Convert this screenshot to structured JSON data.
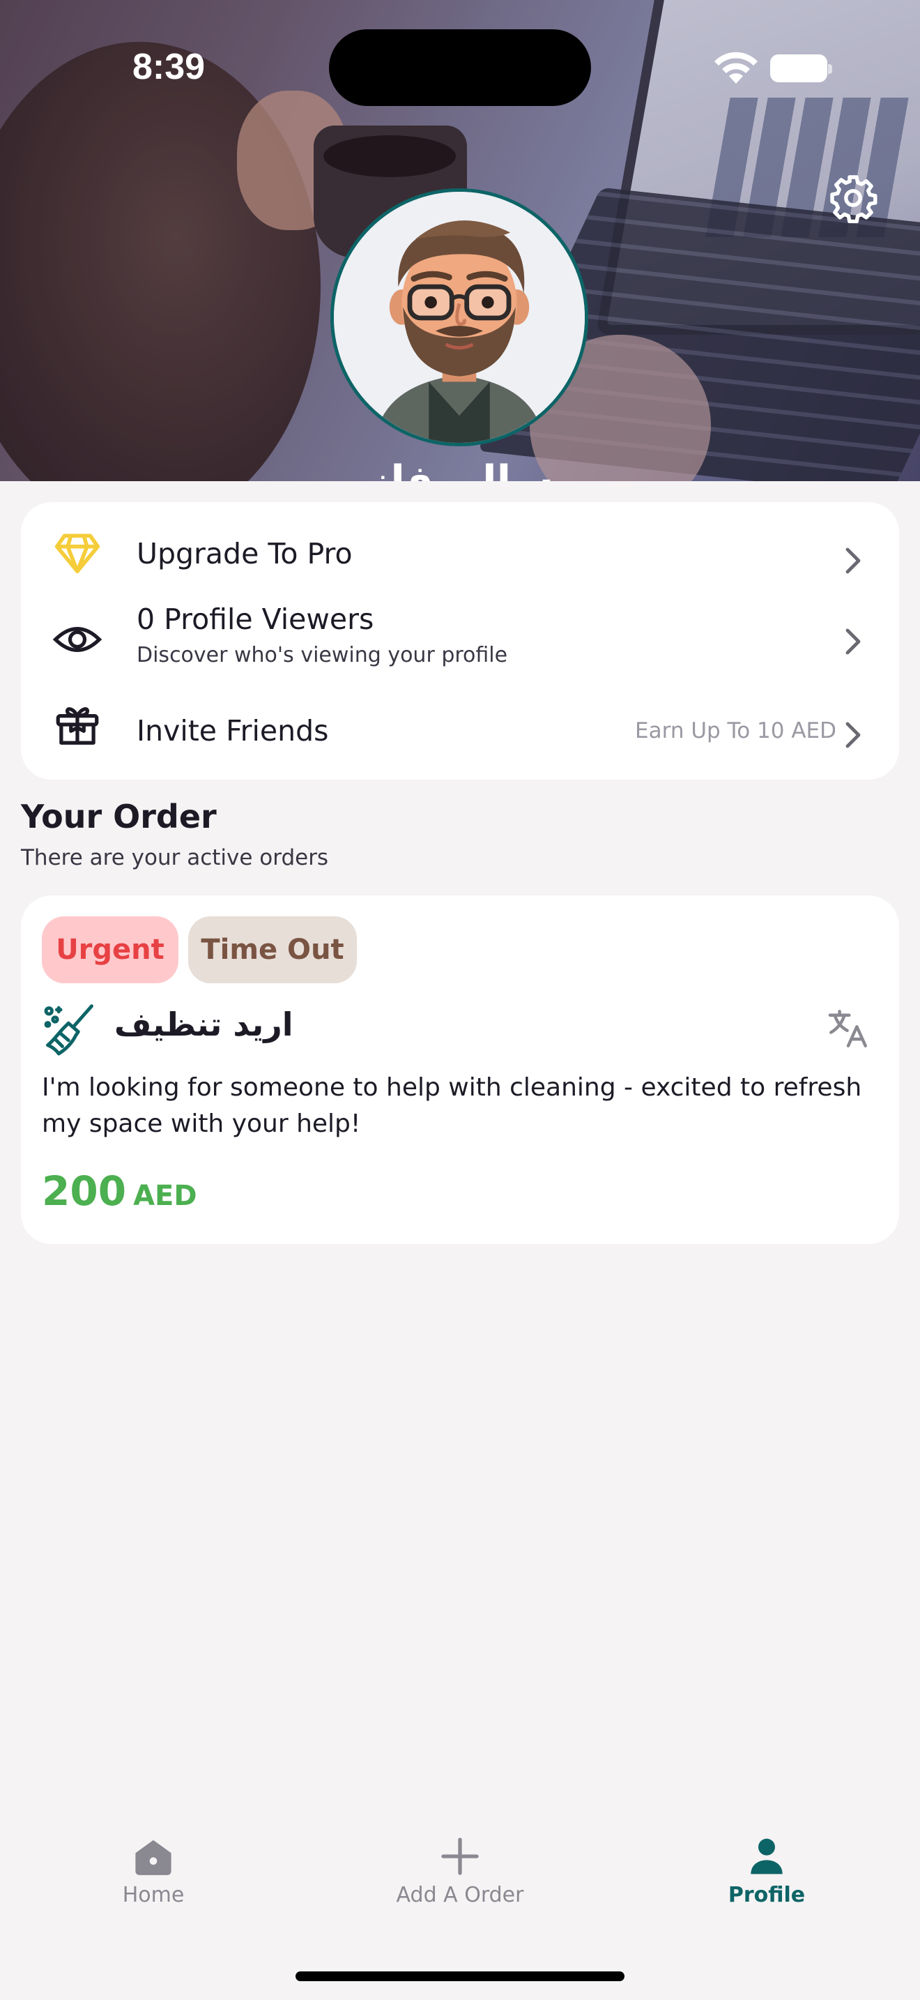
{
  "status_bar": {
    "time": "8:39"
  },
  "header": {
    "profile_name": "سالم فاز",
    "settings_icon": "gear-icon"
  },
  "menu": {
    "items": [
      {
        "icon": "diamond-icon",
        "label": "Upgrade To Pro",
        "subtitle": "",
        "trailing": ""
      },
      {
        "icon": "eye-icon",
        "label": "0 Profile Viewers",
        "subtitle": "Discover who's viewing your profile",
        "trailing": ""
      },
      {
        "icon": "gift-icon",
        "label": "Invite Friends",
        "subtitle": "",
        "trailing": "Earn Up To 10 AED"
      }
    ]
  },
  "orders_section": {
    "title": "Your Order",
    "subtitle": "There are your active orders"
  },
  "order": {
    "badges": [
      "Urgent",
      "Time Out"
    ],
    "category_icon": "broom-icon",
    "title": "اريد تنظيف",
    "translate_icon": "translate-icon",
    "description": "I'm looking for someone to help with cleaning - excited to refresh my space with your help!",
    "price": "200",
    "currency": "AED"
  },
  "tabbar": {
    "tabs": [
      {
        "label": "Home",
        "icon": "home-icon",
        "active": false
      },
      {
        "label": "Add A Order",
        "icon": "plus-icon",
        "active": false
      },
      {
        "label": "Profile",
        "icon": "person-icon",
        "active": true
      }
    ]
  },
  "colors": {
    "accent": "#0d6466",
    "urgent_bg": "#ffc9cc",
    "urgent_text": "#e74144",
    "timeout_bg": "#e7ded8",
    "timeout_text": "#7a5442",
    "price": "#4caf50",
    "pro_icon": "#f5cd3a"
  }
}
